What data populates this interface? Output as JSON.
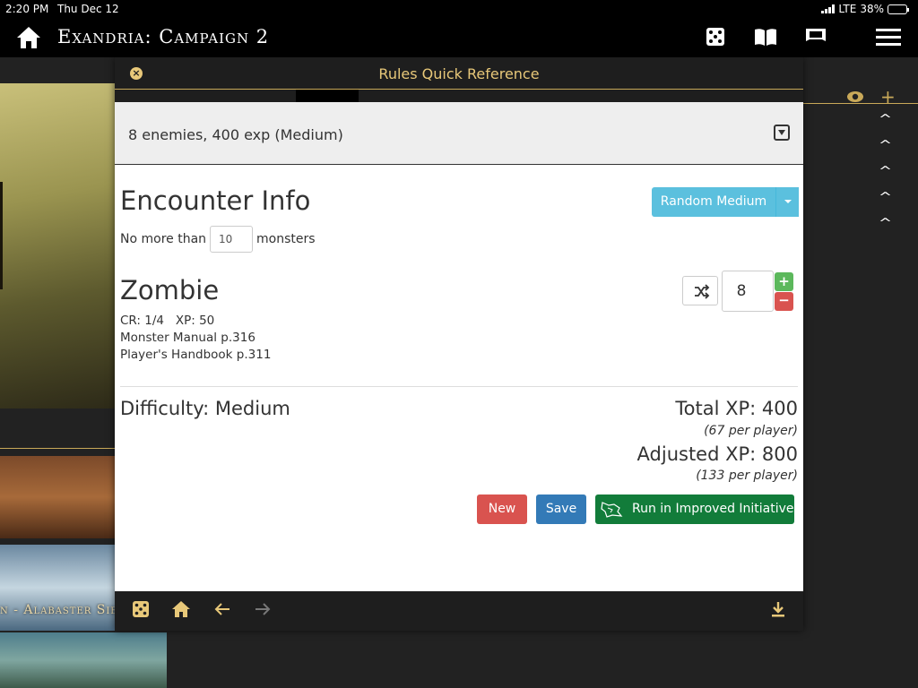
{
  "status": {
    "time": "2:20 PM",
    "date": "Thu Dec 12",
    "carrier": "LTE",
    "battery": "38%",
    "battery_level": 0.38
  },
  "app": {
    "title": "Exandria: Campaign 2"
  },
  "background": {
    "card_label": "n - Alabaster Sie"
  },
  "modal": {
    "title": "Rules Quick Reference",
    "summary": "8 enemies, 400 exp (Medium)",
    "encounter": {
      "heading": "Encounter Info",
      "random_label": "Random Medium",
      "limit_prefix": "No more than",
      "limit_value": "10",
      "limit_suffix": "monsters"
    },
    "monster": {
      "name": "Zombie",
      "cr": "CR: 1/4",
      "xp": "XP: 50",
      "source1": "Monster Manual p.316",
      "source2": "Player's Handbook p.311",
      "count": "8",
      "plus": "+",
      "minus": "−"
    },
    "results": {
      "difficulty": "Difficulty: Medium",
      "total_xp": "Total XP: 400",
      "total_per": "(67 per player)",
      "adjusted_xp": "Adjusted XP: 800",
      "adjusted_per": "(133 per player)"
    },
    "actions": {
      "new": "New",
      "save": "Save",
      "run": "Run in Improved Initiative"
    }
  },
  "colors": {
    "gold": "#c9a959",
    "info": "#5bc0de",
    "danger": "#d9534f",
    "primary": "#337ab7",
    "success_dark": "#127c3a",
    "success": "#5cb85c"
  },
  "icons": [
    "home-icon",
    "dice-icon",
    "book-icon",
    "map-icon",
    "menu-icon",
    "close-icon",
    "eye-icon",
    "plus-icon",
    "chevron-up-icon",
    "shuffle-icon",
    "arrow-left-icon",
    "arrow-right-icon",
    "download-icon",
    "improved-initiative-icon"
  ]
}
